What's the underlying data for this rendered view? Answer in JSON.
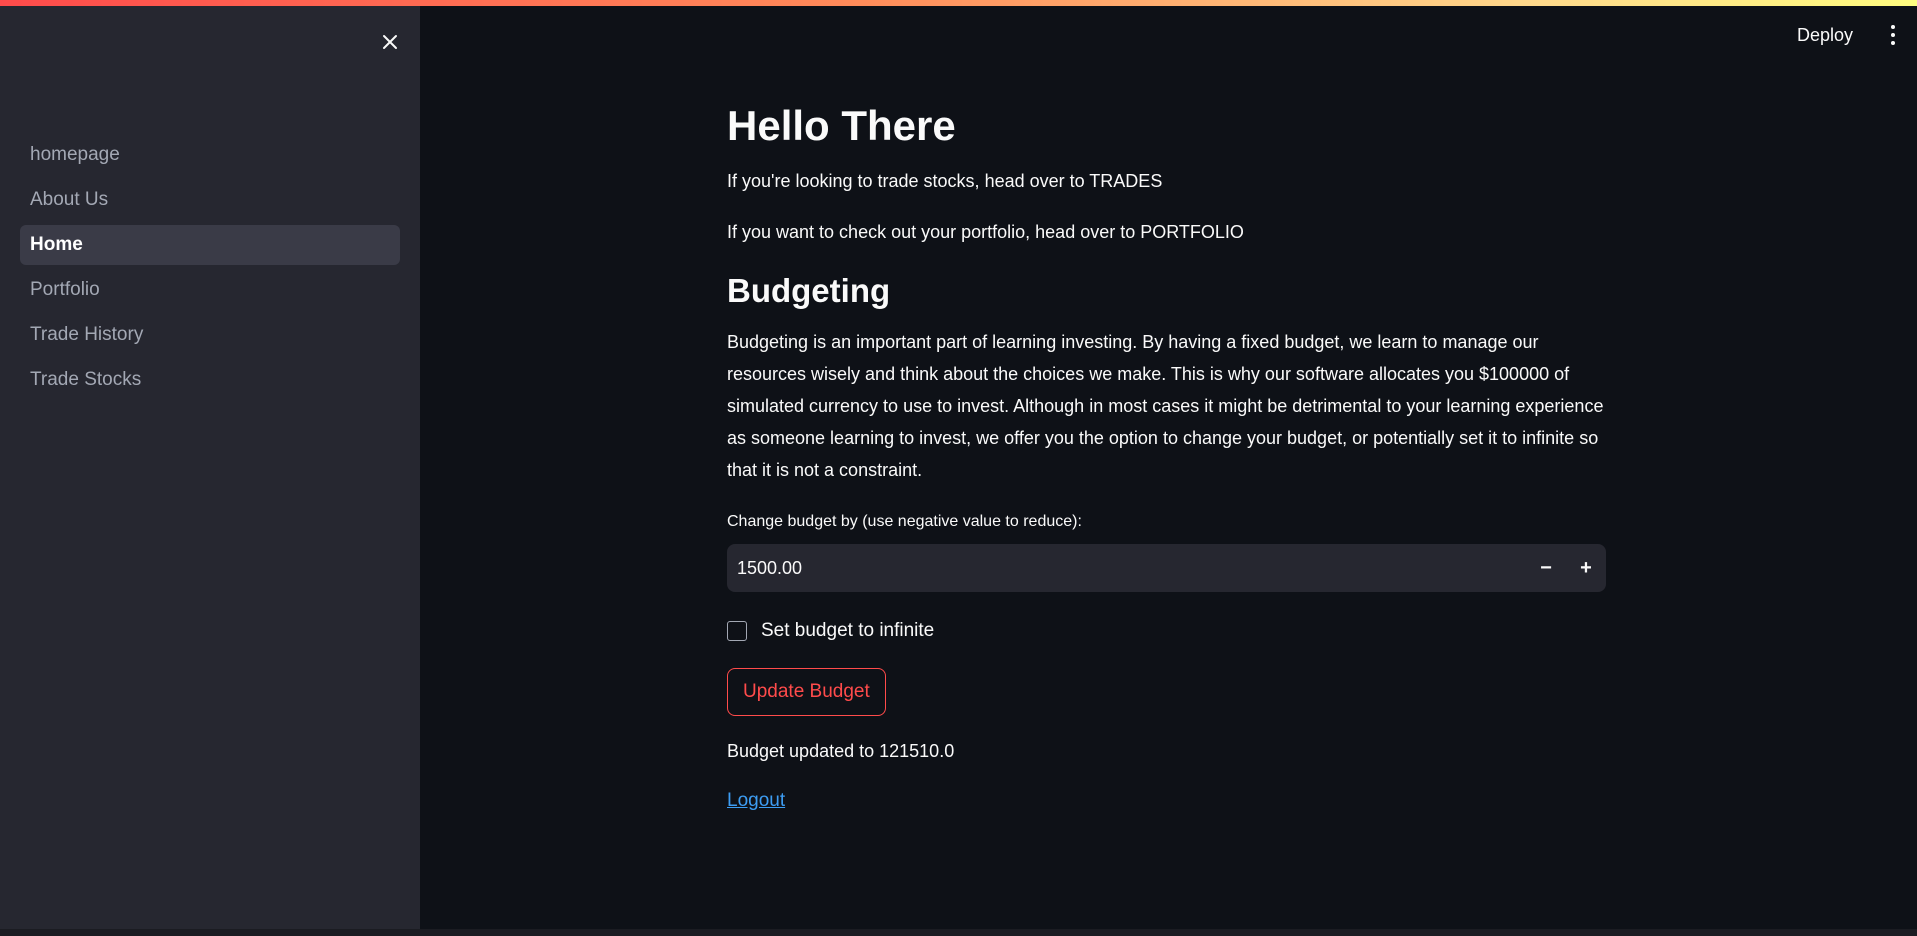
{
  "sidebar": {
    "close_icon": "close-icon",
    "items": [
      {
        "label": "homepage",
        "active": false
      },
      {
        "label": "About Us",
        "active": false
      },
      {
        "label": "Home",
        "active": true
      },
      {
        "label": "Portfolio",
        "active": false
      },
      {
        "label": "Trade History",
        "active": false
      },
      {
        "label": "Trade Stocks",
        "active": false
      }
    ]
  },
  "header": {
    "deploy_label": "Deploy",
    "menu_icon": "vertical-dots-icon"
  },
  "main": {
    "title": "Hello There",
    "line_trades": "If you're looking to trade stocks, head over to TRADES",
    "line_portfolio": "If you want to check out your portfolio, head over to PORTFOLIO",
    "budget_heading": "Budgeting",
    "budget_paragraph": "Budgeting is an important part of learning investing. By having a fixed budget, we learn to manage our resources wisely and think about the choices we make. This is why our software allocates you $100000 of simulated currency to use to invest. Although in most cases it might be detrimental to your learning experience as someone learning to invest, we offer you the option to change your budget, or potentially set it to infinite so that it is not a constraint.",
    "budget_input": {
      "label": "Change budget by (use negative value to reduce):",
      "value": "1500.00",
      "minus": "−",
      "plus": "+"
    },
    "infinite_checkbox": {
      "label": "Set budget to infinite",
      "checked": false
    },
    "update_button": "Update Budget",
    "status": "Budget updated to 121510.0",
    "logout": "Logout"
  },
  "colors": {
    "accent": "#ff4b4b",
    "link": "#3d9df3",
    "background": "#0e1117",
    "sidebar": "#262730"
  }
}
